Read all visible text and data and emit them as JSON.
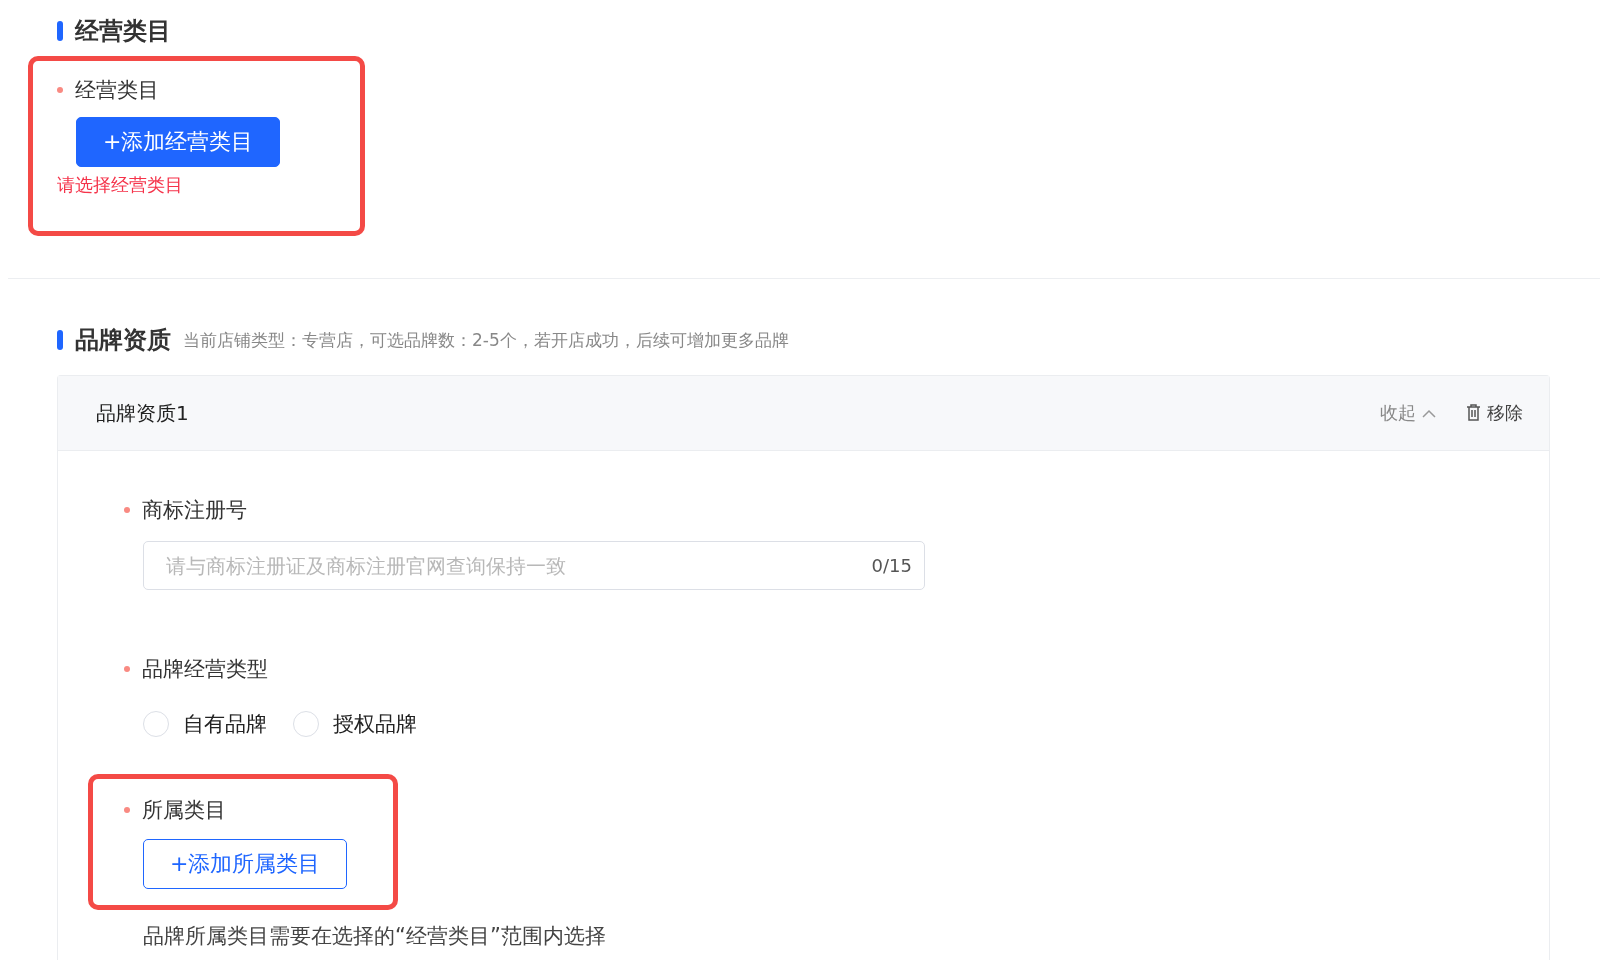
{
  "category_section": {
    "title": "经营类目",
    "field": {
      "label": "经营类目",
      "required": true,
      "highlighted": true,
      "button": "+添加经营类目",
      "primary": true,
      "error": "请选择经营类目"
    }
  },
  "brand_section": {
    "title": "品牌资质",
    "subtitle": "当前店铺类型：专营店，可选品牌数：2-5个，若开店成功，后续可增加更多品牌",
    "cards": [
      {
        "title": "品牌资质1",
        "collapse": "收起",
        "remove": "移除",
        "expanded": true,
        "fields": [
          {
            "kind": "text",
            "label": "商标注册号",
            "required": true,
            "placeholder": "请与商标注册证及商标注册官网查询保持一致",
            "counter": "0/15"
          },
          {
            "kind": "radio",
            "label": "品牌经营类型",
            "required": true,
            "options": [
              {
                "label": "自有品牌",
                "selected": false
              },
              {
                "label": "授权品牌",
                "selected": false
              }
            ]
          },
          {
            "kind": "button",
            "label": "所属类目",
            "required": true,
            "highlighted": true,
            "button": "+添加所属类目",
            "primary": false,
            "hint": "品牌所属类目需要在选择的“经营类目”范围内选择"
          }
        ]
      }
    ]
  }
}
